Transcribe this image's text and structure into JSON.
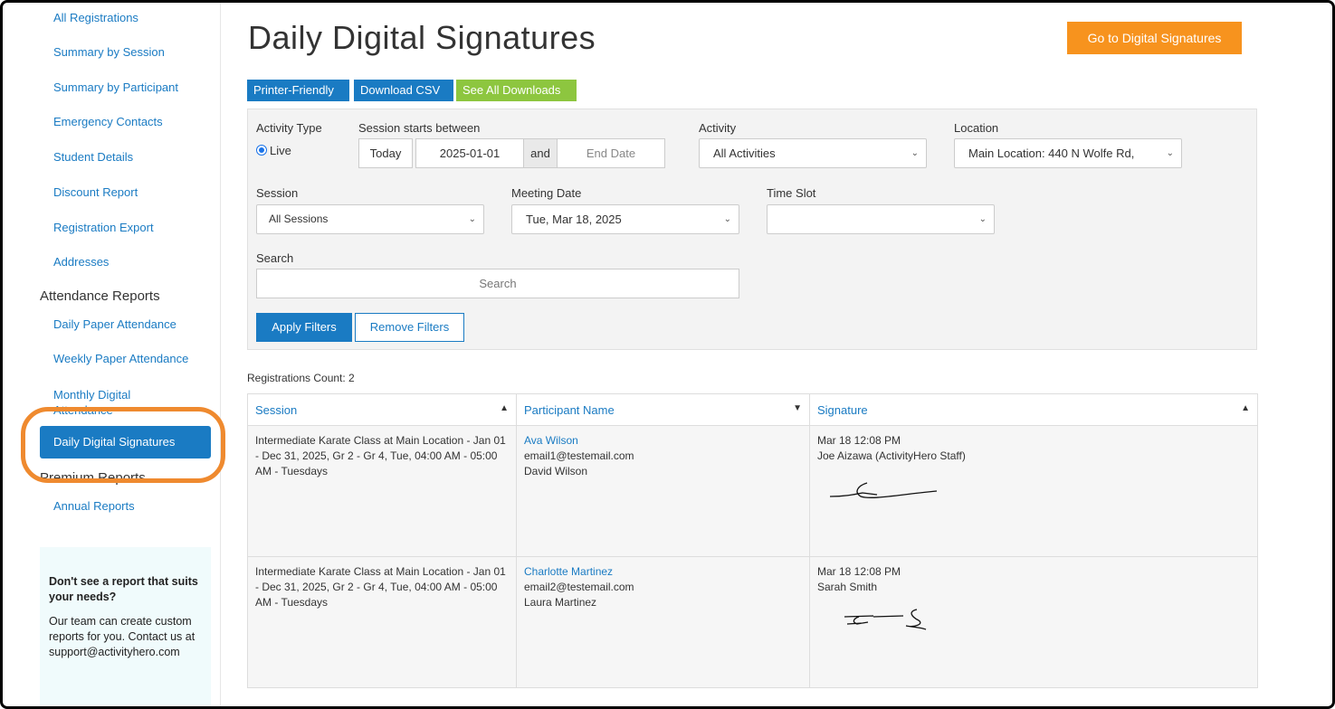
{
  "sidebar": {
    "items_top": [
      "All Registrations",
      "Summary by Session",
      "Summary by Participant",
      "Emergency Contacts",
      "Student Details",
      "Discount Report",
      "Registration Export",
      "Addresses"
    ],
    "attendance_heading": "Attendance Reports",
    "attendance_items": [
      "Daily Paper Attendance",
      "Weekly Paper Attendance",
      "Monthly Digital Attendance"
    ],
    "active_item": "Daily Digital Signatures",
    "premium_heading": "Premium Reports",
    "premium_items": [
      "Annual Reports"
    ],
    "help": {
      "title": "Don't see a report that suits your needs?",
      "body": "Our team can create custom reports for you. Contact us at support@activityhero.com"
    }
  },
  "page": {
    "title": "Daily Digital Signatures",
    "go_button": "Go to Digital Signatures",
    "buttons": {
      "printer": "Printer-Friendly",
      "csv": "Download CSV",
      "all": "See All Downloads"
    }
  },
  "filters": {
    "activity_type_label": "Activity Type",
    "activity_type_value": "Live",
    "session_starts_label": "Session starts between",
    "today": "Today",
    "start_date": "2025-01-01",
    "and": "and",
    "end_placeholder": "End Date",
    "activity_label": "Activity",
    "activity_value": "All Activities",
    "location_label": "Location",
    "location_value": "Main Location: 440 N Wolfe Rd,",
    "session_label": "Session",
    "session_value": "All Sessions",
    "meeting_date_label": "Meeting Date",
    "meeting_date_value": "Tue, Mar 18, 2025",
    "time_slot_label": "Time Slot",
    "time_slot_value": "",
    "search_label": "Search",
    "search_placeholder": "Search",
    "apply": "Apply Filters",
    "remove": "Remove Filters"
  },
  "registrations_count": "Registrations Count: 2",
  "table": {
    "headers": [
      "Session",
      "Participant Name",
      "Signature"
    ],
    "rows": [
      {
        "session": "Intermediate Karate Class at Main Location - Jan 01 - Dec 31, 2025, Gr 2 - Gr 4, Tue, 04:00 AM - 05:00 AM - Tuesdays",
        "participant": "Ava Wilson",
        "email": "email1@testemail.com",
        "parent": "David Wilson",
        "sig_time": "Mar 18 12:08 PM",
        "sig_name": "Joe Aizawa (ActivityHero Staff)"
      },
      {
        "session": "Intermediate Karate Class at Main Location - Jan 01 - Dec 31, 2025, Gr 2 - Gr 4, Tue, 04:00 AM - 05:00 AM - Tuesdays",
        "participant": "Charlotte Martinez",
        "email": "email2@testemail.com",
        "parent": "Laura Martinez",
        "sig_time": "Mar 18 12:08 PM",
        "sig_name": "Sarah Smith"
      }
    ]
  },
  "colors": {
    "primary": "#1a7bc3",
    "orange": "#f7931e",
    "green": "#8dc63f",
    "highlight": "#ef8a2f"
  }
}
